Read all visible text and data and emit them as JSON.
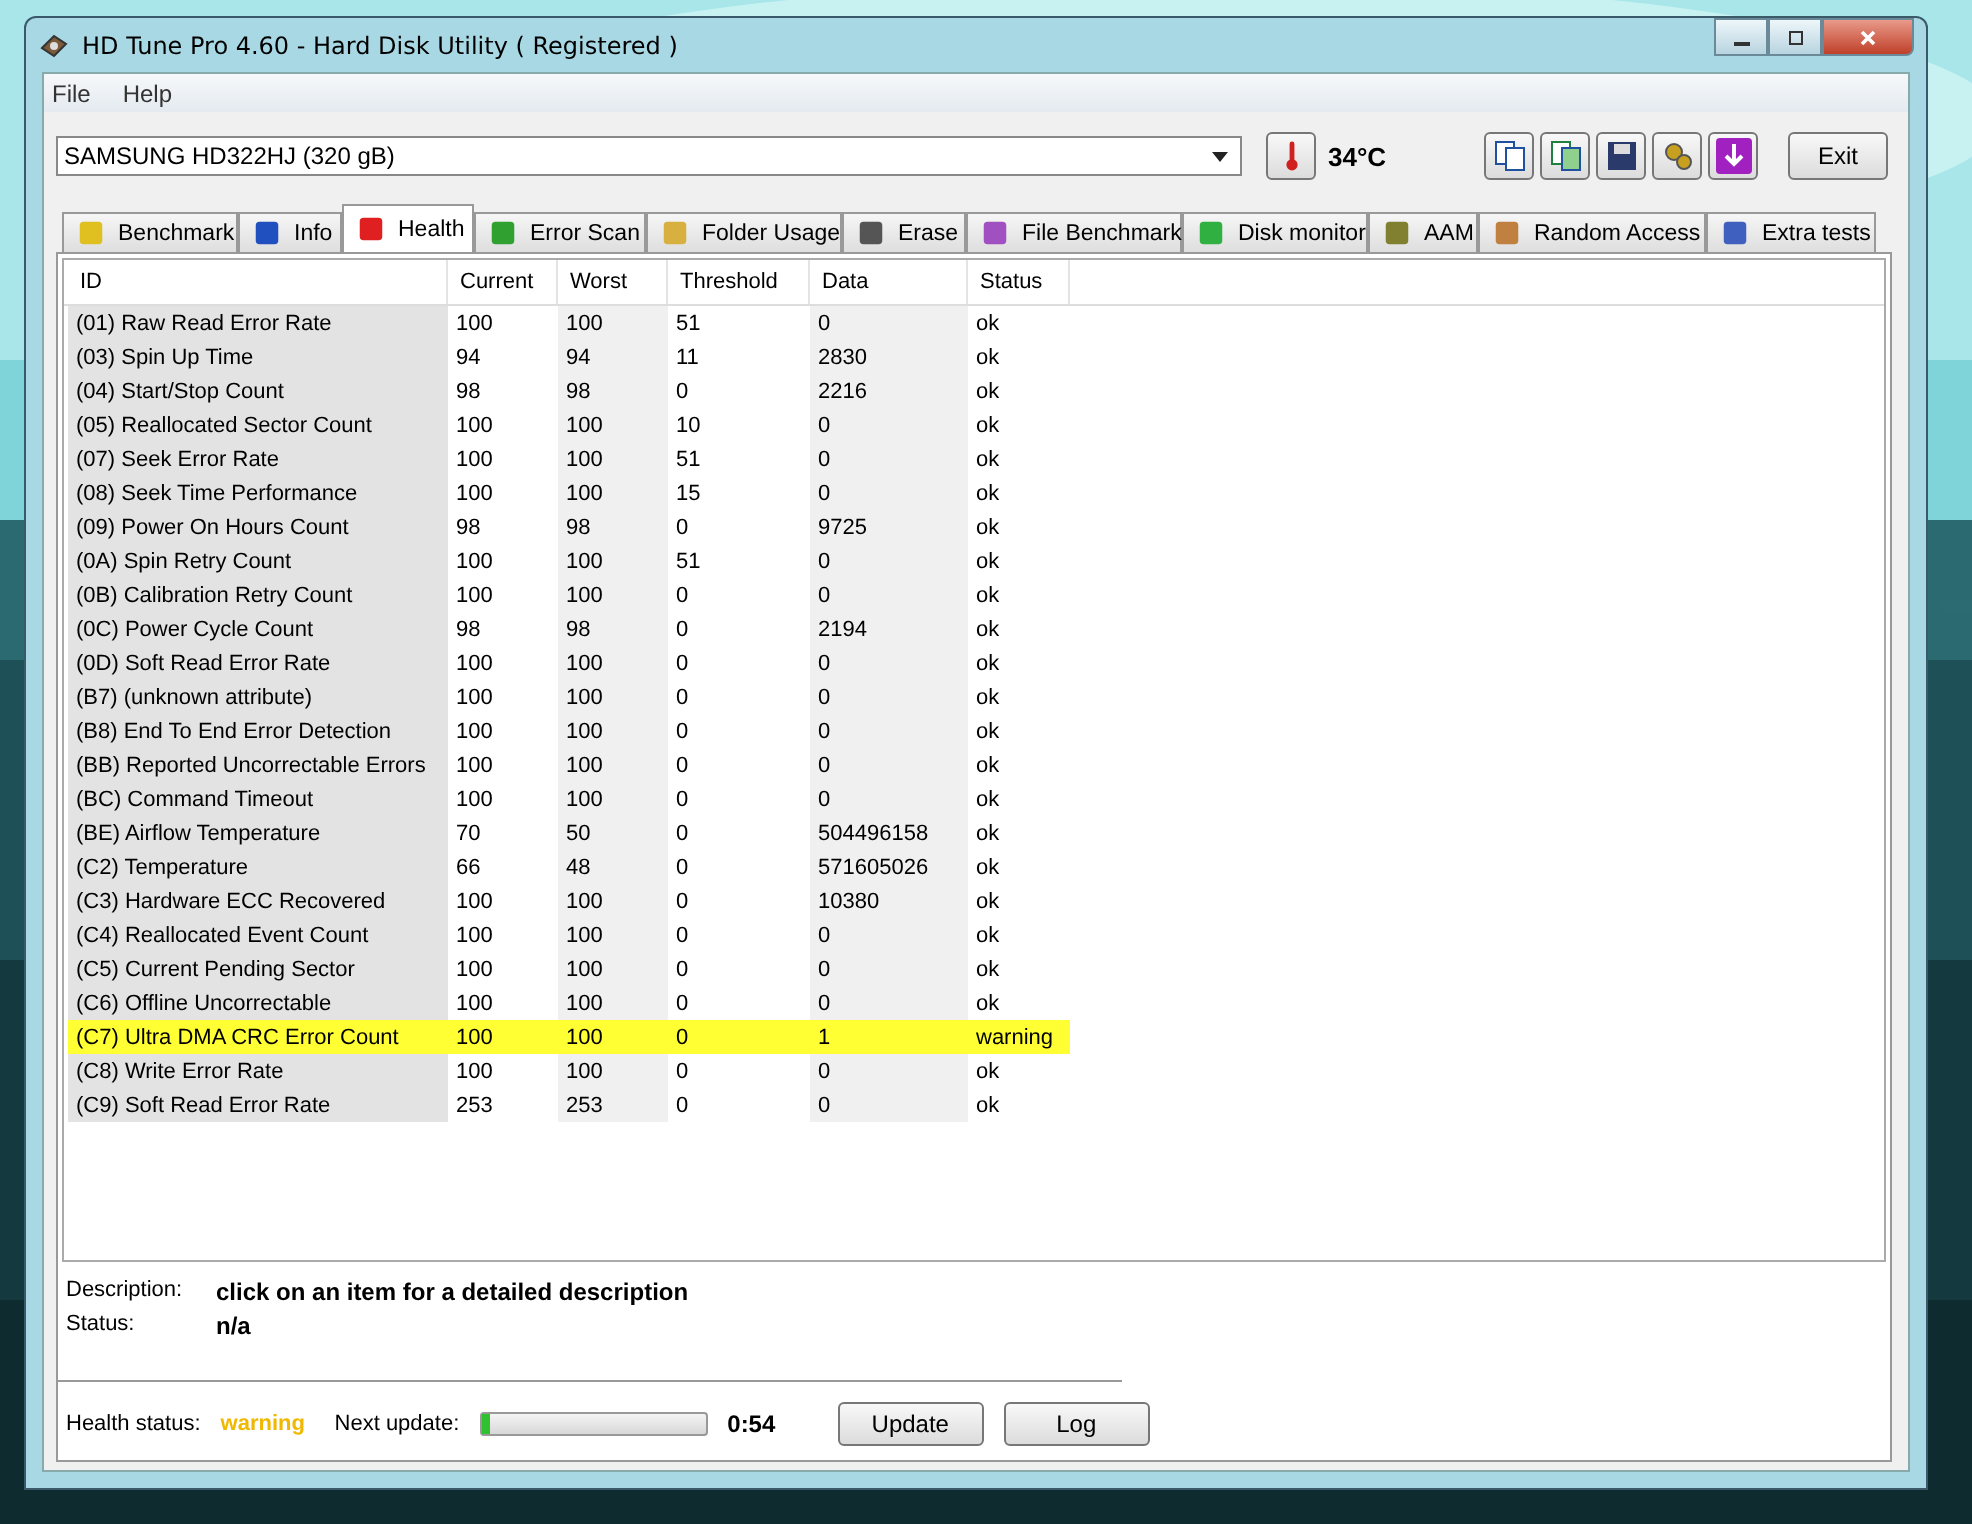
{
  "window": {
    "title": "HD Tune Pro 4.60 - Hard Disk Utility (  Registered )"
  },
  "menu": [
    "File",
    "Help"
  ],
  "toolbar": {
    "drive": "SAMSUNG HD322HJ (320 gB)",
    "temperature": "34°C",
    "exit": "Exit"
  },
  "tabs": [
    {
      "label": "Benchmark",
      "selected": false
    },
    {
      "label": "Info",
      "selected": false
    },
    {
      "label": "Health",
      "selected": true
    },
    {
      "label": "Error Scan",
      "selected": false
    },
    {
      "label": "Folder Usage",
      "selected": false
    },
    {
      "label": "Erase",
      "selected": false
    },
    {
      "label": "File Benchmark",
      "selected": false
    },
    {
      "label": "Disk monitor",
      "selected": false
    },
    {
      "label": "AAM",
      "selected": false
    },
    {
      "label": "Random Access",
      "selected": false
    },
    {
      "label": "Extra tests",
      "selected": false
    }
  ],
  "table": {
    "columns": [
      "ID",
      "Current",
      "Worst",
      "Threshold",
      "Data",
      "Status"
    ],
    "rows": [
      {
        "cells": [
          "(01) Raw Read Error Rate",
          "100",
          "100",
          "51",
          "0",
          "ok"
        ],
        "warning": false
      },
      {
        "cells": [
          "(03) Spin Up Time",
          "94",
          "94",
          "11",
          "2830",
          "ok"
        ],
        "warning": false
      },
      {
        "cells": [
          "(04) Start/Stop Count",
          "98",
          "98",
          "0",
          "2216",
          "ok"
        ],
        "warning": false
      },
      {
        "cells": [
          "(05) Reallocated Sector Count",
          "100",
          "100",
          "10",
          "0",
          "ok"
        ],
        "warning": false
      },
      {
        "cells": [
          "(07) Seek Error Rate",
          "100",
          "100",
          "51",
          "0",
          "ok"
        ],
        "warning": false
      },
      {
        "cells": [
          "(08) Seek Time Performance",
          "100",
          "100",
          "15",
          "0",
          "ok"
        ],
        "warning": false
      },
      {
        "cells": [
          "(09) Power On Hours Count",
          "98",
          "98",
          "0",
          "9725",
          "ok"
        ],
        "warning": false
      },
      {
        "cells": [
          "(0A) Spin Retry Count",
          "100",
          "100",
          "51",
          "0",
          "ok"
        ],
        "warning": false
      },
      {
        "cells": [
          "(0B) Calibration Retry Count",
          "100",
          "100",
          "0",
          "0",
          "ok"
        ],
        "warning": false
      },
      {
        "cells": [
          "(0C) Power Cycle Count",
          "98",
          "98",
          "0",
          "2194",
          "ok"
        ],
        "warning": false
      },
      {
        "cells": [
          "(0D) Soft Read Error Rate",
          "100",
          "100",
          "0",
          "0",
          "ok"
        ],
        "warning": false
      },
      {
        "cells": [
          "(B7) (unknown attribute)",
          "100",
          "100",
          "0",
          "0",
          "ok"
        ],
        "warning": false
      },
      {
        "cells": [
          "(B8) End To End Error Detection",
          "100",
          "100",
          "0",
          "0",
          "ok"
        ],
        "warning": false
      },
      {
        "cells": [
          "(BB) Reported Uncorrectable Errors",
          "100",
          "100",
          "0",
          "0",
          "ok"
        ],
        "warning": false
      },
      {
        "cells": [
          "(BC) Command Timeout",
          "100",
          "100",
          "0",
          "0",
          "ok"
        ],
        "warning": false
      },
      {
        "cells": [
          "(BE) Airflow Temperature",
          "70",
          "50",
          "0",
          "504496158",
          "ok"
        ],
        "warning": false
      },
      {
        "cells": [
          "(C2) Temperature",
          "66",
          "48",
          "0",
          "571605026",
          "ok"
        ],
        "warning": false
      },
      {
        "cells": [
          "(C3) Hardware ECC Recovered",
          "100",
          "100",
          "0",
          "10380",
          "ok"
        ],
        "warning": false
      },
      {
        "cells": [
          "(C4) Reallocated Event Count",
          "100",
          "100",
          "0",
          "0",
          "ok"
        ],
        "warning": false
      },
      {
        "cells": [
          "(C5) Current Pending Sector",
          "100",
          "100",
          "0",
          "0",
          "ok"
        ],
        "warning": false
      },
      {
        "cells": [
          "(C6) Offline Uncorrectable",
          "100",
          "100",
          "0",
          "0",
          "ok"
        ],
        "warning": false
      },
      {
        "cells": [
          "(C7) Ultra DMA CRC Error Count",
          "100",
          "100",
          "0",
          "1",
          "warning"
        ],
        "warning": true
      },
      {
        "cells": [
          "(C8) Write Error Rate",
          "100",
          "100",
          "0",
          "0",
          "ok"
        ],
        "warning": false
      },
      {
        "cells": [
          "(C9) Soft Read Error Rate",
          "253",
          "253",
          "0",
          "0",
          "ok"
        ],
        "warning": false
      }
    ]
  },
  "details": [
    {
      "label": "Description:",
      "value": "click on an item for a detailed description"
    },
    {
      "label": "Status:",
      "value": "n/a"
    }
  ],
  "footer": {
    "health_label": "Health status:",
    "health_value": "warning",
    "health_warning": true,
    "update_label": "Next update:",
    "level": 0.04,
    "countdown": "0:54",
    "buttons": [
      "Update",
      "Log"
    ]
  }
}
